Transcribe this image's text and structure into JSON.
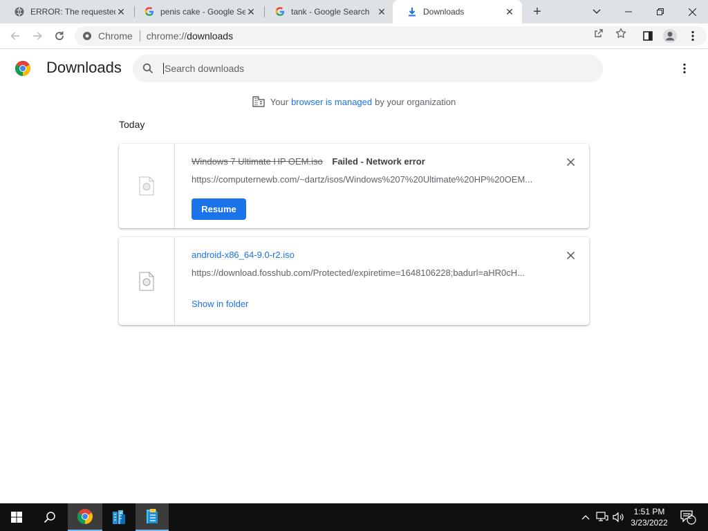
{
  "tabs": [
    {
      "title": "ERROR: The requested",
      "favicon": "error-globe-icon",
      "active": false
    },
    {
      "title": "penis cake - Google Se",
      "favicon": "google-icon",
      "active": false
    },
    {
      "title": "tank - Google Search",
      "favicon": "google-icon",
      "active": false
    },
    {
      "title": "Downloads",
      "favicon": "download-icon",
      "active": true
    }
  ],
  "toolbar": {
    "chip_label": "Chrome",
    "url_scheme": "chrome://",
    "url_host": "downloads"
  },
  "downloads": {
    "page_title": "Downloads",
    "search_placeholder": "Search downloads",
    "managed_prefix": "Your",
    "managed_link": "browser is managed",
    "managed_suffix": "by your organization",
    "section_label": "Today",
    "items": [
      {
        "filename": "Windows 7 Ultimate HP OEM.iso",
        "status": "Failed - Network error",
        "url": "https://computernewb.com/~dartz/isos/Windows%207%20Ultimate%20HP%20OEM...",
        "action_label": "Resume"
      },
      {
        "filename": "android-x86_64-9.0-r2.iso",
        "url": "https://download.fosshub.com/Protected/expiretime=1648106228;badurl=aHR0cH...",
        "action_label": "Show in folder"
      }
    ]
  },
  "taskbar": {
    "time": "1:51 PM",
    "date": "3/23/2022",
    "notification_count": "2"
  },
  "colors": {
    "accent": "#1a73e8",
    "tabstrip": "#dee1e6",
    "taskbar": "#101010"
  }
}
